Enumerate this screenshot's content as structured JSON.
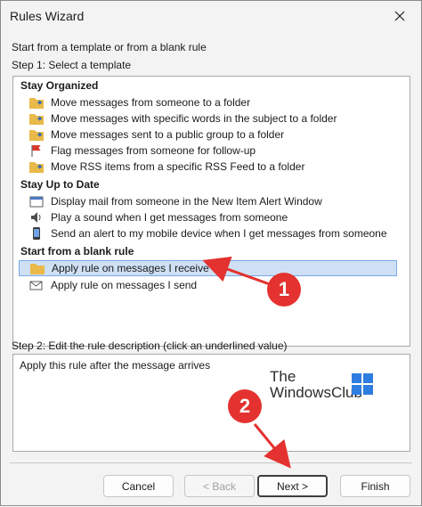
{
  "window": {
    "title": "Rules Wizard"
  },
  "intro": "Start from a template or from a blank rule",
  "step1_label": "Step 1: Select a template",
  "groups": [
    {
      "header": "Stay Organized",
      "items": [
        {
          "label": "Move messages from someone to a folder",
          "icon": "folder-arrow-icon"
        },
        {
          "label": "Move messages with specific words in the subject to a folder",
          "icon": "folder-arrow-icon"
        },
        {
          "label": "Move messages sent to a public group to a folder",
          "icon": "folder-arrow-icon"
        },
        {
          "label": "Flag messages from someone for follow-up",
          "icon": "flag-icon"
        },
        {
          "label": "Move RSS items from a specific RSS Feed to a folder",
          "icon": "folder-arrow-icon"
        }
      ]
    },
    {
      "header": "Stay Up to Date",
      "items": [
        {
          "label": "Display mail from someone in the New Item Alert Window",
          "icon": "alert-window-icon"
        },
        {
          "label": "Play a sound when I get messages from someone",
          "icon": "speaker-icon"
        },
        {
          "label": "Send an alert to my mobile device when I get messages from someone",
          "icon": "mobile-icon"
        }
      ]
    },
    {
      "header": "Start from a blank rule",
      "items": [
        {
          "label": "Apply rule on messages I receive",
          "icon": "inbox-icon",
          "selected": true
        },
        {
          "label": "Apply rule on messages I send",
          "icon": "send-mail-icon"
        }
      ]
    }
  ],
  "step2_label": "Step 2: Edit the rule description (click an underlined value)",
  "description": "Apply this rule after the message arrives",
  "watermark": {
    "line1": "The",
    "line2": "WindowsClub"
  },
  "buttons": {
    "cancel": "Cancel",
    "back": "< Back",
    "next": "Next >",
    "finish": "Finish"
  },
  "callouts": {
    "one": "1",
    "two": "2"
  },
  "colors": {
    "selection": "#cfe0f5",
    "callout": "#e3322f",
    "folder": "#e9b949",
    "flag": "#d83b2d"
  }
}
